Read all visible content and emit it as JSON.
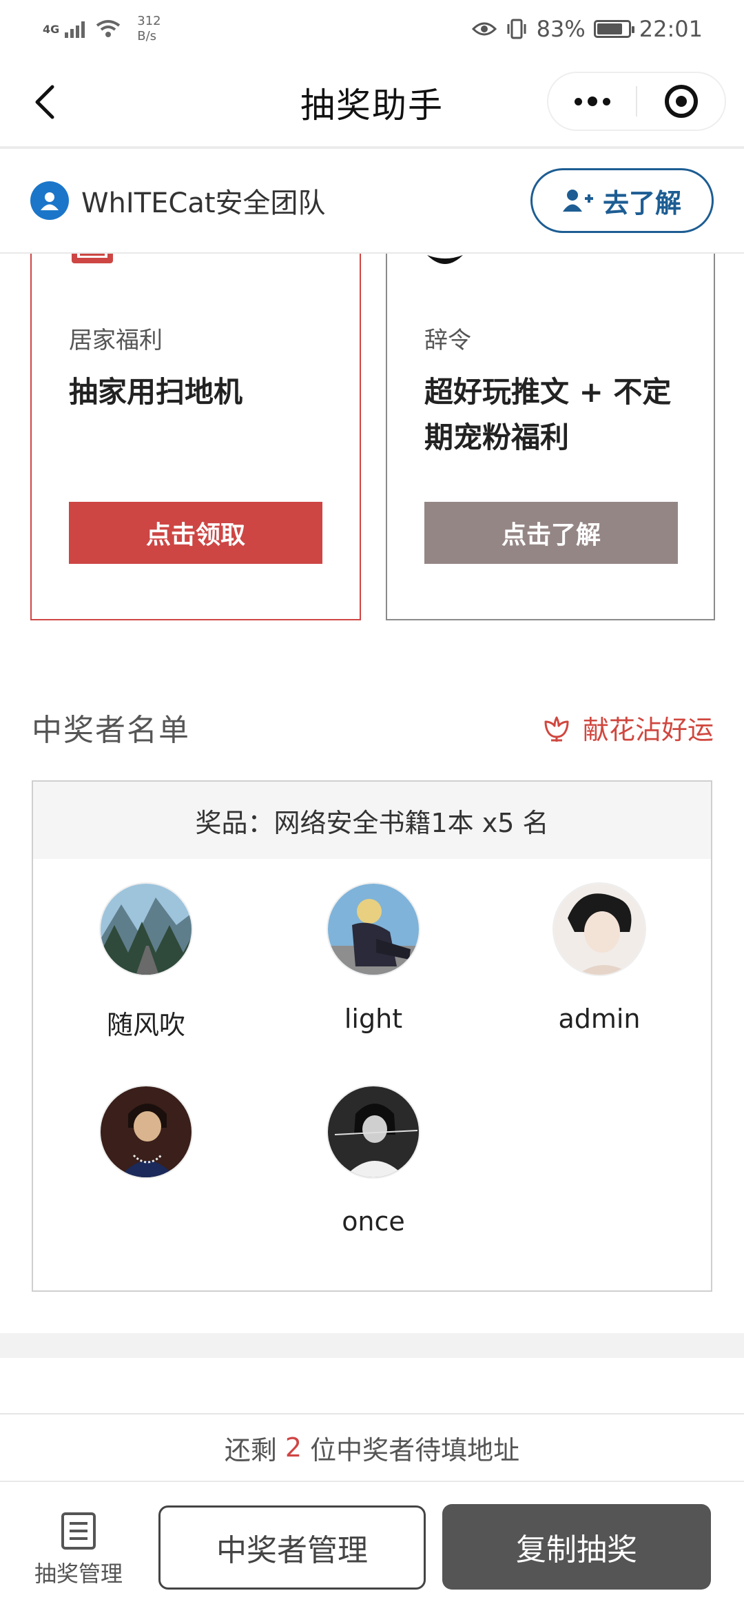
{
  "status_bar": {
    "network": "4G",
    "speed_value": "312",
    "speed_unit": "B/s",
    "battery_percent": "83%",
    "battery_level": 0.83,
    "time": "22:01"
  },
  "nav": {
    "title": "抽奖助手"
  },
  "sponsor": {
    "name": "WhITECat安全团队",
    "button_label": "去了解"
  },
  "cards": [
    {
      "category": "居家福利",
      "title": "抽家用扫地机",
      "button_label": "点击领取"
    },
    {
      "category": "辞令",
      "title": "超好玩推文 + 不定期宠粉福利",
      "button_label": "点击了解"
    }
  ],
  "winners_section": {
    "title": "中奖者名单",
    "flower_label": "献花沾好运",
    "prize": "奖品：网络安全书籍1本 x5 名",
    "winners": [
      {
        "name": "随风吹"
      },
      {
        "name": "light"
      },
      {
        "name": "admin"
      },
      {
        "name": ""
      },
      {
        "name": "once"
      }
    ]
  },
  "remaining": {
    "prefix": "还剩",
    "count": "2",
    "suffix": "位中奖者待填地址"
  },
  "bottom_bar": {
    "manage_label": "抽奖管理",
    "winner_manage_label": "中奖者管理",
    "copy_label": "复制抽奖"
  },
  "colors": {
    "accent_red": "#cd4644",
    "sponsor_blue": "#1d5d93",
    "muted_button": "#958686",
    "dark_button": "#555555"
  }
}
